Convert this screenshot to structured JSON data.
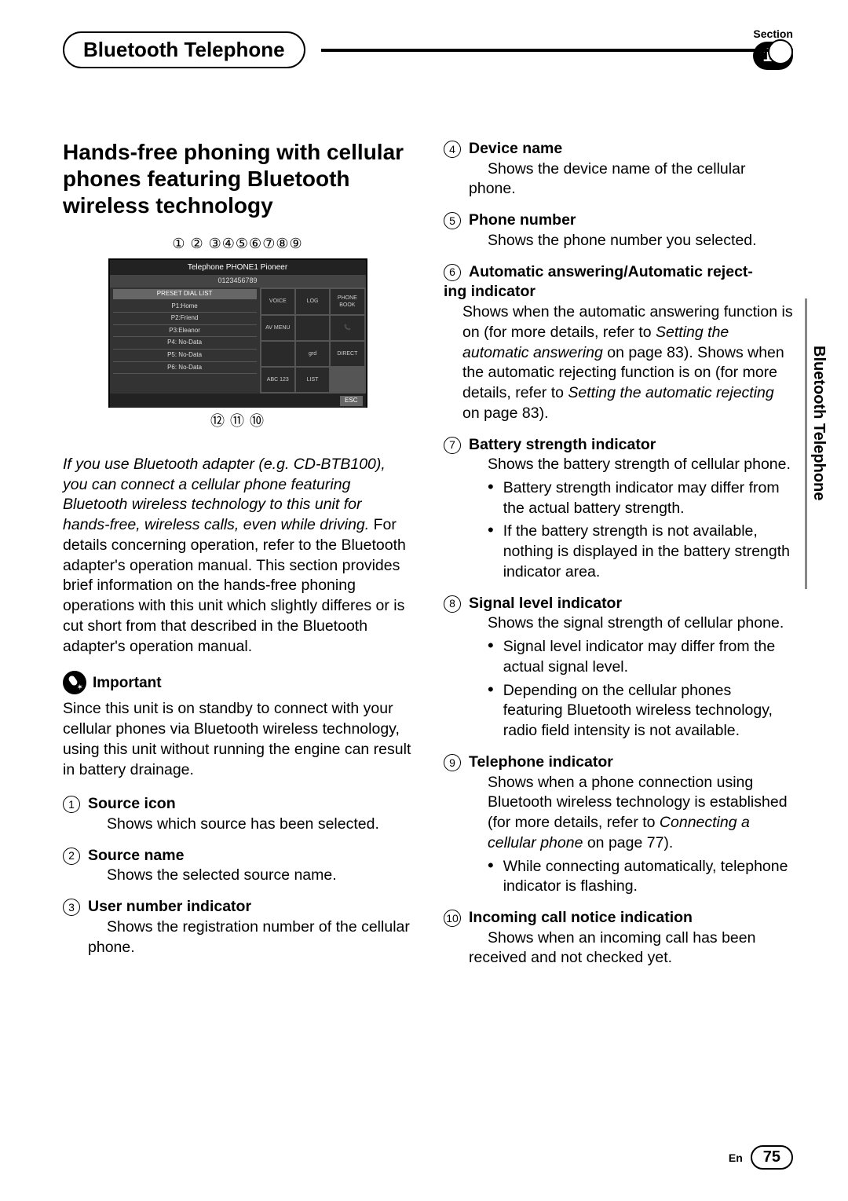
{
  "header": {
    "section_title": "Bluetooth Telephone",
    "section_word": "Section",
    "section_number": "17"
  },
  "side_tab": "Bluetooth Telephone",
  "main_heading": "Hands-free phoning with cellular phones featuring Bluetooth wireless technology",
  "diagram": {
    "top_numbers": "① ② ③④⑤⑥⑦⑧⑨",
    "bottom_numbers": "⑫   ⑪ ⑩",
    "header": "Telephone PHONE1 Pioneer",
    "sub": "0123456789",
    "list_title": "PRESET DIAL LIST",
    "list_items": [
      "P1:Home",
      "P2:Friend",
      "P3:Eleanor",
      "P4: No-Data",
      "P5: No-Data",
      "P6: No-Data"
    ],
    "buttons": [
      "VOICE",
      "LOG",
      "PHONE BOOK",
      "AV MENU",
      "",
      "",
      "",
      "grd",
      "DIRECT",
      "ABC 123",
      "LIST"
    ],
    "esc": "ESC"
  },
  "intro_italic": "If you use Bluetooth adapter (e.g. CD-BTB100), you can connect a cellular phone featuring Bluetooth wireless technology to this unit for hands-free, wireless calls, even while driving.",
  "intro_rest": "For details concerning operation, refer to the Bluetooth adapter's operation manual. This section provides brief information on the hands-free phoning operations with this unit which slightly differes or is cut short from that described in the Bluetooth adapter's operation manual.",
  "important_label": "Important",
  "important_body": "Since this unit is on standby to connect with your cellular phones via Bluetooth wireless technology, using this unit without running the engine can result in battery drainage.",
  "items": {
    "1": {
      "num": "1",
      "title": "Source icon",
      "body": "Shows which source has been selected."
    },
    "2": {
      "num": "2",
      "title": "Source name",
      "body": "Shows the selected source name."
    },
    "3": {
      "num": "3",
      "title": "User number indicator",
      "body": "Shows the registration number of the cellular phone."
    },
    "4": {
      "num": "4",
      "title": "Device name",
      "body": "Shows the device name of the cellular phone."
    },
    "5": {
      "num": "5",
      "title": "Phone number",
      "body": "Shows the phone number you selected."
    },
    "6": {
      "num": "6",
      "title_prefix": "Automatic answering/Automatic reject-",
      "title_suffix": "ing indicator",
      "body1": "Shows when the automatic answering function is on (for more details, refer to ",
      "ref1": "Setting the automatic answering",
      "body2": " on page 83). Shows when the automatic rejecting function is on (for more details, refer to ",
      "ref2": "Setting the automatic rejecting",
      "body3": " on page 83)."
    },
    "7": {
      "num": "7",
      "title": "Battery strength indicator",
      "body": "Shows the battery strength of cellular phone.",
      "bullets": [
        "Battery strength indicator may differ from the actual battery strength.",
        "If the battery strength is not available, nothing is displayed in the battery strength indicator area."
      ]
    },
    "8": {
      "num": "8",
      "title": "Signal level indicator",
      "body": "Shows the signal strength of cellular phone.",
      "bullets": [
        "Signal level indicator may differ from the actual signal level.",
        "Depending on the cellular phones featuring Bluetooth wireless technology, radio field intensity is not available."
      ]
    },
    "9": {
      "num": "9",
      "title": "Telephone indicator",
      "body1": "Shows when a phone connection using Bluetooth wireless technology is established (for more details, refer to ",
      "ref": "Connecting a cellular phone",
      "body2": " on page 77).",
      "bullets": [
        "While connecting automatically, telephone indicator is flashing."
      ]
    },
    "10": {
      "num": "10",
      "title": "Incoming call notice indication",
      "body": "Shows when an incoming call has been received and not checked yet."
    }
  },
  "footer": {
    "lang": "En",
    "page": "75"
  }
}
